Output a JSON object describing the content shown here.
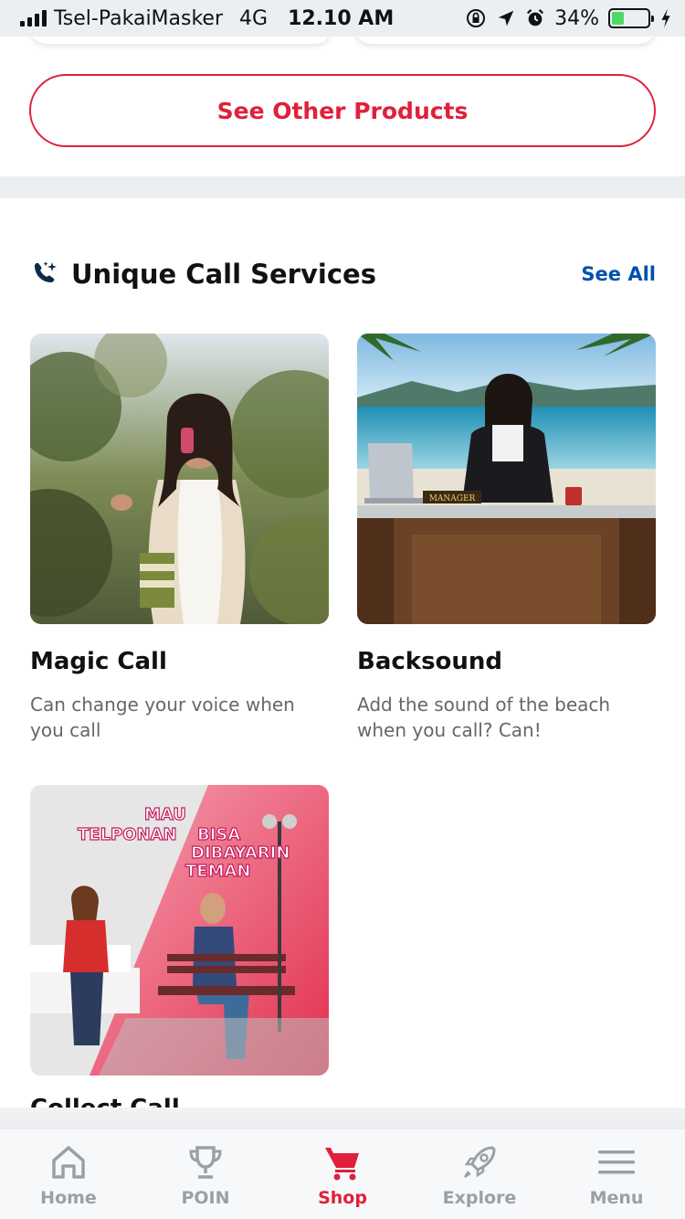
{
  "status_bar": {
    "carrier": "Tsel-PakaiMasker",
    "network": "4G",
    "time": "12.10 AM",
    "battery": "34%",
    "battery_level": 0.34,
    "icons": [
      "signal-icon",
      "rotation-lock-icon",
      "location-icon",
      "alarm-icon",
      "battery-icon",
      "charging-icon"
    ]
  },
  "top_section": {
    "see_other_label": "See Other Products"
  },
  "call_services": {
    "icon": "call-sparkle-icon",
    "title": "Unique Call Services",
    "see_all_label": "See All",
    "cards": [
      {
        "title": "Magic Call",
        "description": "Can change your voice when you call"
      },
      {
        "title": "Backsound",
        "description": "Add the sound of the beach when you call? Can!"
      },
      {
        "title": "Collect Call",
        "description": "",
        "image_text": [
          "MAU",
          "TELPONAN",
          "BISA",
          "DIBAYARIN",
          "TEMAN"
        ]
      }
    ],
    "manager_plaque": "MANAGER"
  },
  "bottom_nav": {
    "items": [
      {
        "label": "Home",
        "icon": "home-icon",
        "active": false
      },
      {
        "label": "POIN",
        "icon": "trophy-icon",
        "active": false
      },
      {
        "label": "Shop",
        "icon": "cart-icon",
        "active": true
      },
      {
        "label": "Explore",
        "icon": "rocket-icon",
        "active": false
      },
      {
        "label": "Menu",
        "icon": "hamburger-icon",
        "active": false
      }
    ]
  },
  "colors": {
    "brand_red": "#e0203a",
    "link_blue": "#0050ae",
    "inactive_gray": "#9aa0a6"
  }
}
